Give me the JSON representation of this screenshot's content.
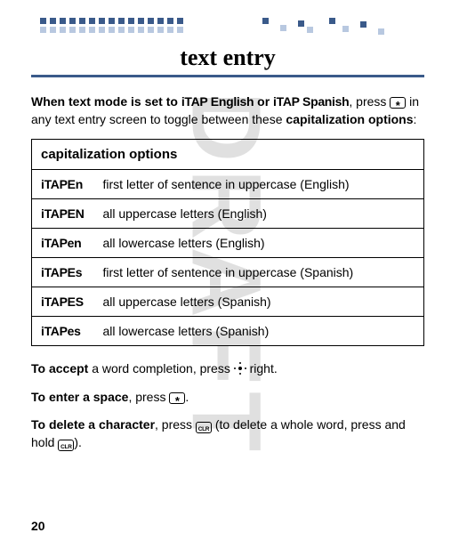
{
  "page_number": "20",
  "watermark": "DRAFT",
  "title": "text entry",
  "intro": {
    "pre": "When text mode is set to",
    "mode1": "iTAP English",
    "or": "or",
    "mode2": "iTAP Spanish",
    "post1": ", press ",
    "post2": " in any text entry screen to toggle between these ",
    "cap_label": "capitalization options",
    "post3": ":"
  },
  "table": {
    "header": "capitalization options",
    "rows": [
      {
        "k": "iTAPEn",
        "v": "first letter of sentence in uppercase (English)"
      },
      {
        "k": "iTAPEN",
        "v": "all uppercase letters (English)"
      },
      {
        "k": "iTAPen",
        "v": "all lowercase letters (English)"
      },
      {
        "k": "iTAPEs",
        "v": "first letter of sentence in uppercase (Spanish)"
      },
      {
        "k": "iTAPES",
        "v": "all uppercase letters (Spanish)"
      },
      {
        "k": "iTAPes",
        "v": "all lowercase letters (Spanish)"
      }
    ]
  },
  "accept": {
    "b": "To accept",
    "t1": " a word completion, press ",
    "t2": " right."
  },
  "space": {
    "b": "To enter a space",
    "t1": ", press ",
    "t2": "."
  },
  "delete": {
    "b": "To delete a character",
    "t1": ", press ",
    "t2": " (to delete a whole word, press and hold ",
    "t3": ")."
  }
}
